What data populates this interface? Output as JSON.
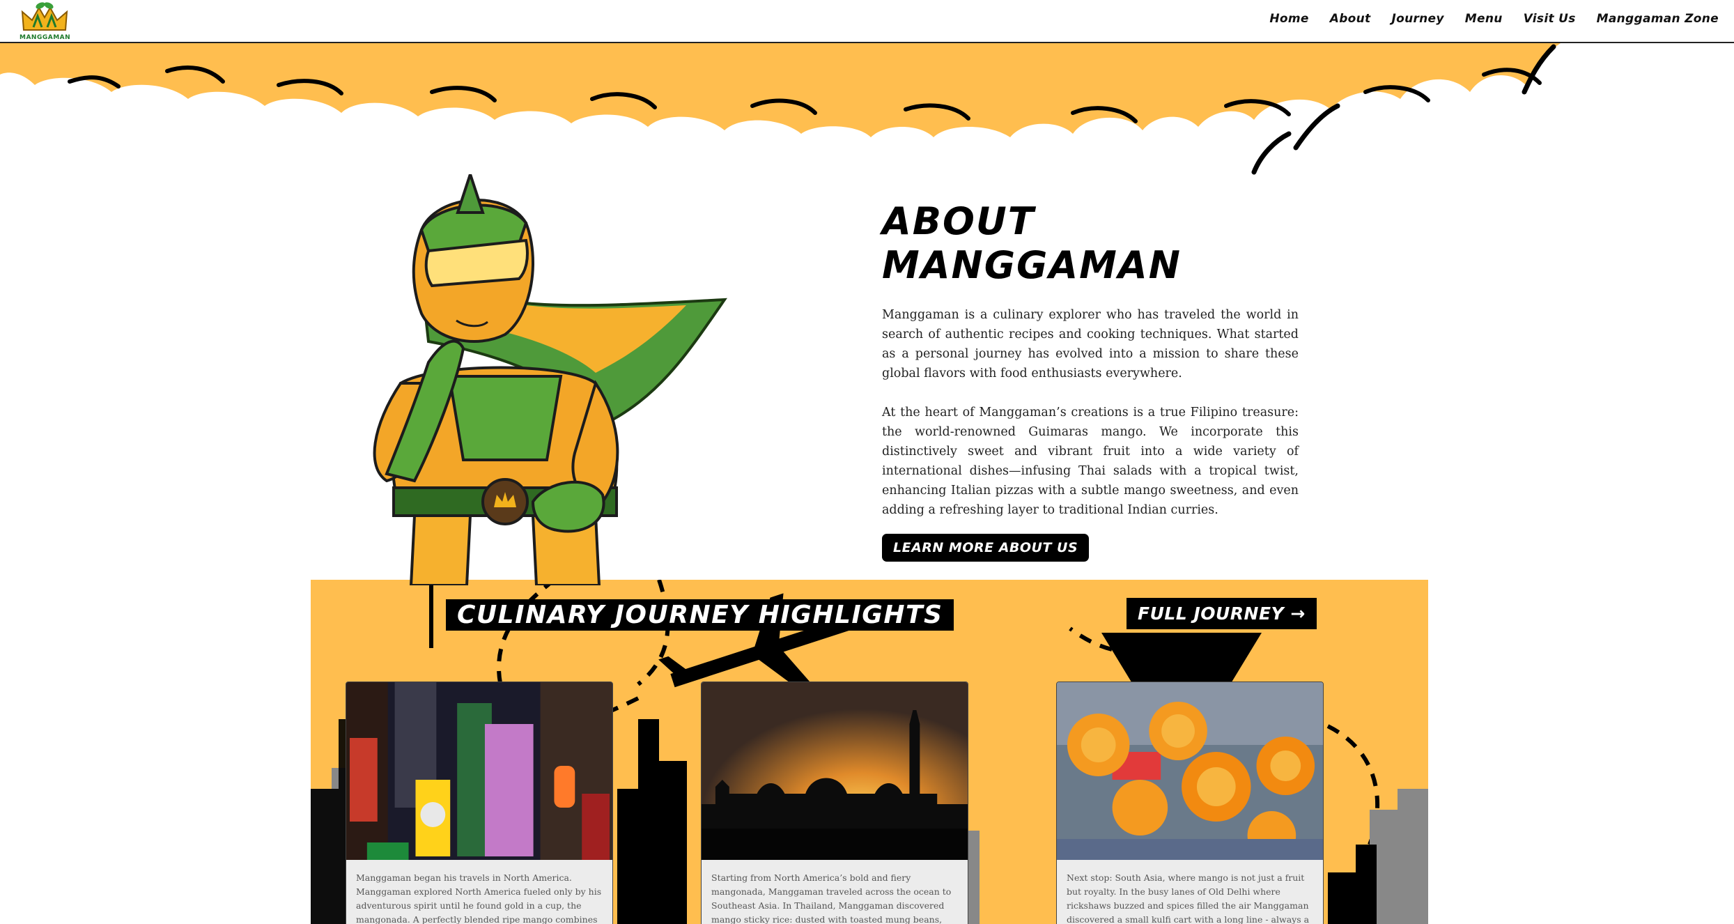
{
  "header": {
    "logo_text": "MANGGAMAN",
    "nav": [
      {
        "label": "Home"
      },
      {
        "label": "About"
      },
      {
        "label": "Journey"
      },
      {
        "label": "Menu"
      },
      {
        "label": "Visit Us"
      },
      {
        "label": "Manggaman Zone"
      }
    ]
  },
  "about": {
    "title": "About Manggaman",
    "paragraphs": [
      "Manggaman is a culinary explorer who has traveled the world in search of authentic recipes and cooking techniques. What started as a personal journey has evolved into a mission to share these global flavors with food enthusiasts everywhere.",
      "At the heart of Manggaman’s creations is a true Filipino treasure: the world-renowned Guimaras mango. We incorporate this distinctively sweet and vibrant fruit into a wide variety of international dishes—infusing Thai salads with a tropical twist, enhancing Italian pizzas with a subtle mango sweetness, and even adding a refreshing layer to traditional Indian curries."
    ],
    "button_label": "Learn More About Us"
  },
  "journey": {
    "title": "Culinary Journey Highlights",
    "full_button_label": "Full Journey",
    "full_button_icon": "arrow-right-icon",
    "cards": [
      {
        "text": "Manggaman began his travels in North America. Manggaman explored North America fueled only by his adventurous spirit until he found gold in a cup, the mangonada. A perfectly blended ripe mango combines with spicy chamoy, lime juice,"
      },
      {
        "text": "Starting from North America’s bold and fiery mangonada, Manggaman traveled across the ocean to Southeast Asia. In Thailand, Manggaman discovered mango sticky rice: dusted with toasted mung beans, golden ripe mango slices atop warm"
      },
      {
        "text": "Next stop: South Asia, where mango is not just a fruit but royalty. In the busy lanes of Old Delhi where rickshaws buzzed and spices filled the air Manggaman discovered a small kulfi cart with a long line - always a good sign. That was the reason"
      }
    ]
  },
  "colors": {
    "accent_yellow": "#ffbe4f",
    "hero_green": "#5aa83a",
    "hero_orange": "#f5a623"
  }
}
